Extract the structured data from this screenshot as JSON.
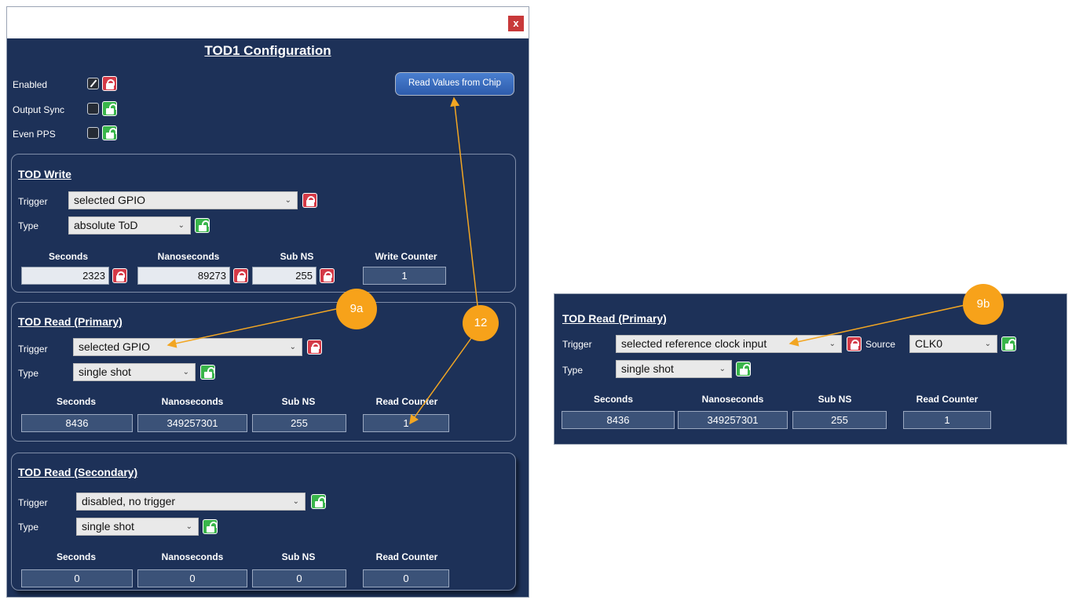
{
  "window": {
    "close_label": "x",
    "title": "TOD1 Configuration"
  },
  "top_options": {
    "enabled_label": "Enabled",
    "output_sync_label": "Output Sync",
    "even_pps_label": "Even PPS",
    "read_button_label": "Read Values from Chip"
  },
  "tod_write": {
    "title": "TOD Write",
    "trigger_label": "Trigger",
    "trigger_value": "selected GPIO",
    "type_label": "Type",
    "type_value": "absolute ToD",
    "headers": [
      "Seconds",
      "Nanoseconds",
      "Sub NS",
      "Write Counter"
    ],
    "seconds": "2323",
    "nanoseconds": "89273",
    "sub_ns": "255",
    "counter": "1"
  },
  "tod_read_primary": {
    "title": "TOD Read (Primary)",
    "trigger_label": "Trigger",
    "trigger_value": "selected GPIO",
    "type_label": "Type",
    "type_value": "single shot",
    "headers": [
      "Seconds",
      "Nanoseconds",
      "Sub NS",
      "Read Counter"
    ],
    "seconds": "8436",
    "nanoseconds": "349257301",
    "sub_ns": "255",
    "counter": "1"
  },
  "tod_read_secondary": {
    "title": "TOD Read (Secondary)",
    "trigger_label": "Trigger",
    "trigger_value": "disabled, no trigger",
    "type_label": "Type",
    "type_value": "single shot",
    "headers": [
      "Seconds",
      "Nanoseconds",
      "Sub NS",
      "Read Counter"
    ],
    "seconds": "0",
    "nanoseconds": "0",
    "sub_ns": "0",
    "counter": "0"
  },
  "side_panel": {
    "title": "TOD Read (Primary)",
    "trigger_label": "Trigger",
    "trigger_value": "selected reference clock input",
    "source_label": "Source",
    "source_value": "CLK0",
    "type_label": "Type",
    "type_value": "single shot",
    "headers": [
      "Seconds",
      "Nanoseconds",
      "Sub NS",
      "Read Counter"
    ],
    "seconds": "8436",
    "nanoseconds": "349257301",
    "sub_ns": "255",
    "counter": "1"
  },
  "callouts": {
    "c9a": "9a",
    "c12": "12",
    "c9b": "9b"
  },
  "colors": {
    "panel_bg": "#1d3158",
    "lock_locked": "#d43a47",
    "lock_unlocked": "#39b54a",
    "callout": "#f7a21a",
    "button": "#3a6cc0"
  }
}
